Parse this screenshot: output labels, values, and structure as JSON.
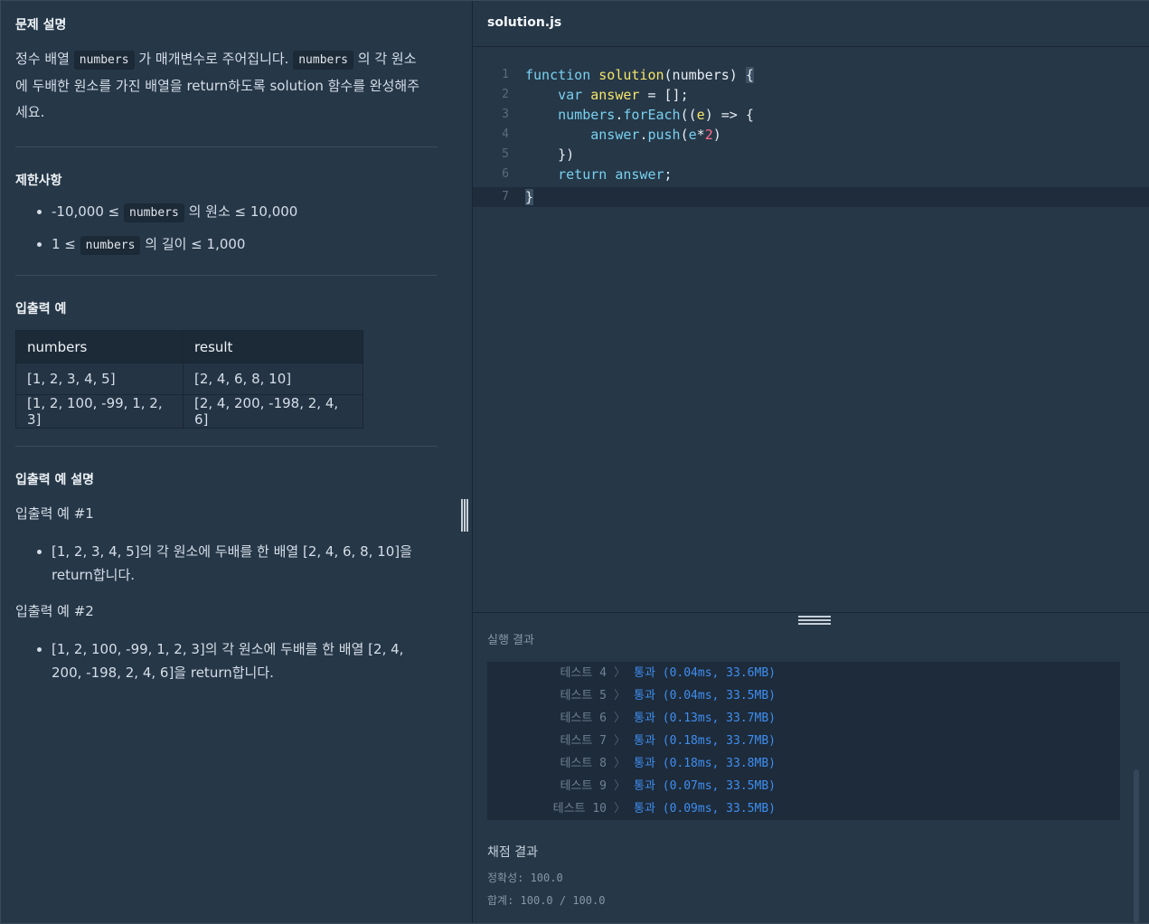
{
  "left": {
    "desc_title": "문제 설명",
    "desc": {
      "p1": "정수 배열",
      "code1": "numbers",
      "p2": "가 매개변수로 주어집니다.",
      "code2": "numbers",
      "p3": "의 각 원소",
      "p4": "에 두배한 원소를 가진 배열을 return하도록 solution 함수를 완성해주",
      "p5": "세요."
    },
    "constraints_title": "제한사항",
    "constraints": [
      {
        "pre": "-10,000 ≤",
        "code": "numbers",
        "post": "의 원소 ≤ 10,000"
      },
      {
        "pre": "1 ≤",
        "code": "numbers",
        "post": "의 길이 ≤ 1,000"
      }
    ],
    "io_title": "입출력 예",
    "io_table": {
      "headers": [
        "numbers",
        "result"
      ],
      "rows": [
        [
          "[1, 2, 3, 4, 5]",
          "[2, 4, 6, 8, 10]"
        ],
        [
          "[1, 2, 100, -99, 1, 2, 3]",
          "[2, 4, 200, -198, 2, 4, 6]"
        ]
      ]
    },
    "explain_title": "입출력 예 설명",
    "ex1_label": "입출력 예 #1",
    "ex1_items": [
      "[1, 2, 3, 4, 5]의 각 원소에 두배를 한 배열 [2, 4, 6, 8, 10]을 return합니다."
    ],
    "ex2_label": "입출력 예 #2",
    "ex2_items": [
      "[1, 2, 100, -99, 1, 2, 3]의 각 원소에 두배를 한 배열 [2, 4, 200, -198, 2, 4, 6]을 return합니다."
    ]
  },
  "editor": {
    "tab": "solution.js",
    "lines": [
      "1",
      "2",
      "3",
      "4",
      "5",
      "6",
      "7"
    ],
    "code": {
      "l1": {
        "kw": "function",
        "fn": "solution",
        "args": "(numbers) ",
        "brace": "{"
      },
      "l2": {
        "kw": "var",
        "var": "answer",
        "rest": " = [];"
      },
      "l3": {
        "obj": "numbers",
        "dot": ".",
        "method": "forEach",
        "rest1": "((",
        "param": "e",
        "rest2": ") => {"
      },
      "l4": {
        "obj": "answer",
        "dot": ".",
        "method": "push",
        "rest1": "(",
        "param": "e",
        "op": "*",
        "num": "2",
        "rest2": ")"
      },
      "l5": {
        "rest": "})"
      },
      "l6": {
        "kw": "return",
        "var": "answer",
        "rest": ";"
      },
      "l7": {
        "brace": "}"
      }
    }
  },
  "results": {
    "title": "실행 결과",
    "tests": [
      {
        "name": "테스트 4",
        "sep": "〉",
        "result": "통과 (0.04ms, 33.6MB)"
      },
      {
        "name": "테스트 5",
        "sep": "〉",
        "result": "통과 (0.04ms, 33.5MB)"
      },
      {
        "name": "테스트 6",
        "sep": "〉",
        "result": "통과 (0.13ms, 33.7MB)"
      },
      {
        "name": "테스트 7",
        "sep": "〉",
        "result": "통과 (0.18ms, 33.7MB)"
      },
      {
        "name": "테스트 8",
        "sep": "〉",
        "result": "통과 (0.18ms, 33.8MB)"
      },
      {
        "name": "테스트 9",
        "sep": "〉",
        "result": "통과 (0.07ms, 33.5MB)"
      },
      {
        "name": "테스트 10",
        "sep": "〉",
        "result": "통과 (0.09ms, 33.5MB)"
      }
    ],
    "grading_title": "채점 결과",
    "accuracy": "정확성: 100.0",
    "total": "합계: 100.0 / 100.0"
  },
  "colors": {
    "pass": "#3e8ef0",
    "bg": "#263747",
    "console": "#1e2b3a"
  }
}
